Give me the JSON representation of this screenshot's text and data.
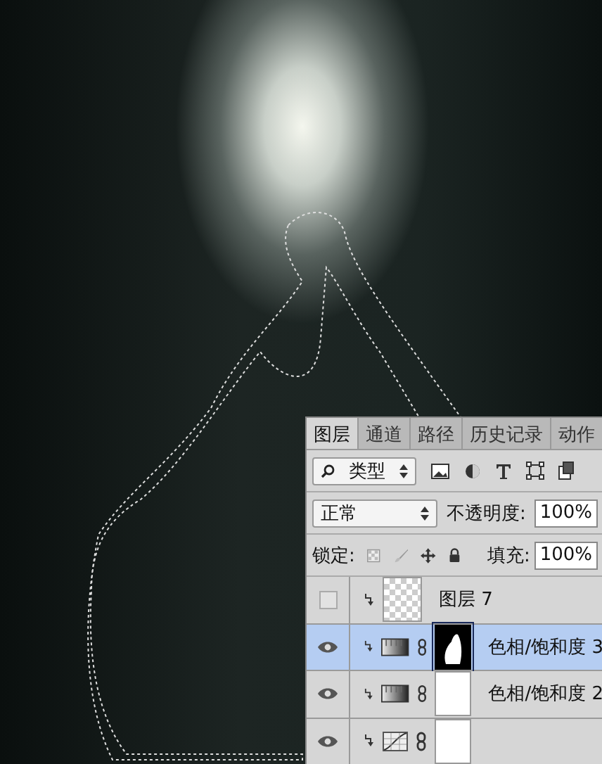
{
  "tabs": [
    {
      "label": "图层",
      "selected": true
    },
    {
      "label": "通道",
      "selected": false
    },
    {
      "label": "路径",
      "selected": false
    },
    {
      "label": "历史记录",
      "selected": false
    },
    {
      "label": "动作",
      "selected": false
    }
  ],
  "filter": {
    "value": "类型"
  },
  "blend_mode": {
    "value": "正常"
  },
  "opacity": {
    "label": "不透明度:",
    "value": "100%"
  },
  "lock": {
    "label": "锁定:"
  },
  "fill": {
    "label": "填充:",
    "value": "100%"
  },
  "layers": [
    {
      "name": "图层 7",
      "kind": "pixel",
      "visible": false,
      "selected": false,
      "clipped": true
    },
    {
      "name": "色相/饱和度 3",
      "kind": "hue_saturation",
      "visible": true,
      "selected": true,
      "clipped": true,
      "mask": true,
      "mask_blank": false
    },
    {
      "name": "色相/饱和度 2",
      "kind": "hue_saturation",
      "visible": true,
      "selected": false,
      "clipped": true,
      "mask": true,
      "mask_blank": true
    },
    {
      "kind": "curves",
      "visible": true,
      "selected": false,
      "clipped": true,
      "mask": true,
      "mask_blank": true
    }
  ]
}
